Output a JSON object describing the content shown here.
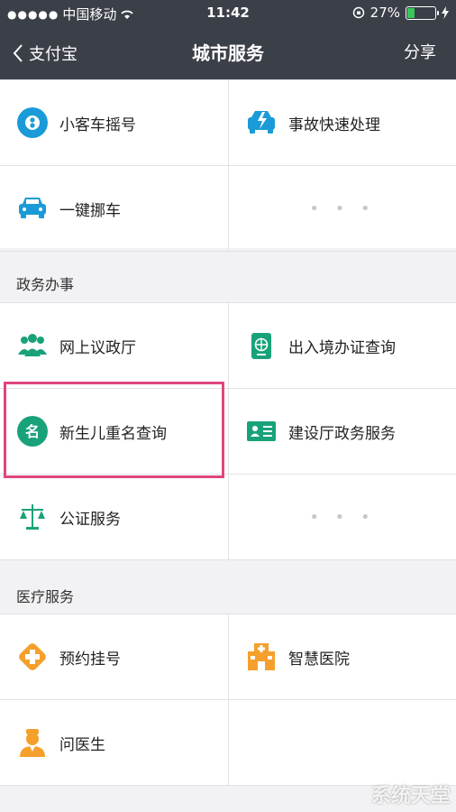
{
  "status": {
    "carrier": "中国移动",
    "time": "11:42",
    "battery": "27%",
    "battery_level": 0.27,
    "signal_dots": "●●●●●"
  },
  "nav": {
    "back_label": "支付宝",
    "title": "城市服务",
    "share_label": "分享"
  },
  "group1": {
    "items": [
      {
        "label": "小客车摇号",
        "icon": "lottery-icon"
      },
      {
        "label": "事故快速处理",
        "icon": "accident-car-icon"
      },
      {
        "label": "一键挪车",
        "icon": "car-icon"
      },
      {
        "label": "• • •",
        "icon": ""
      }
    ]
  },
  "group2": {
    "title": "政务办事",
    "items": [
      {
        "label": "网上议政厅",
        "icon": "people-icon"
      },
      {
        "label": "出入境办证查询",
        "icon": "passport-icon"
      },
      {
        "label": "新生儿重名查询",
        "icon": "name-icon"
      },
      {
        "label": "建设厅政务服务",
        "icon": "id-card-icon"
      },
      {
        "label": "公证服务",
        "icon": "scales-icon"
      },
      {
        "label": "• • •",
        "icon": ""
      }
    ]
  },
  "group3": {
    "title": "医疗服务",
    "items": [
      {
        "label": "预约挂号",
        "icon": "medical-cross-icon"
      },
      {
        "label": "智慧医院",
        "icon": "hospital-icon"
      },
      {
        "label": "问医生",
        "icon": "doctor-icon"
      }
    ]
  },
  "watermark": "系统天堂",
  "colors": {
    "nav_bg": "#3b3f48",
    "highlight": "#e0457f",
    "blue": "#1a9bd7",
    "teal": "#19a27a",
    "orange": "#f5a02c"
  }
}
